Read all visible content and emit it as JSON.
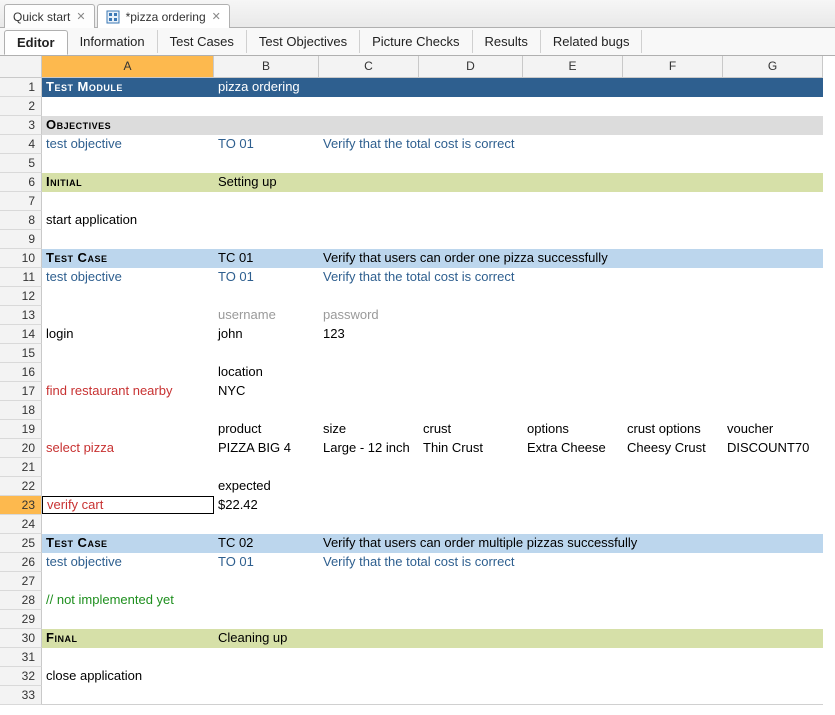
{
  "doc_tabs": [
    {
      "label": "Quick start",
      "active": false,
      "has_icon": false
    },
    {
      "label": "*pizza ordering",
      "active": true,
      "has_icon": true
    }
  ],
  "sub_tabs": [
    {
      "label": "Editor",
      "active": true
    },
    {
      "label": "Information",
      "active": false
    },
    {
      "label": "Test Cases",
      "active": false
    },
    {
      "label": "Test Objectives",
      "active": false
    },
    {
      "label": "Picture Checks",
      "active": false
    },
    {
      "label": "Results",
      "active": false
    },
    {
      "label": "Related bugs",
      "active": false
    }
  ],
  "columns": [
    "A",
    "B",
    "C",
    "D",
    "E",
    "F",
    "G"
  ],
  "selected_col": "A",
  "selected_row": 23,
  "rows": [
    {
      "n": 1,
      "bg": "module",
      "cells": [
        {
          "c": "A",
          "t": "Test Module",
          "cls": "t-head"
        },
        {
          "c": "B",
          "t": "pizza ordering"
        }
      ]
    },
    {
      "n": 2,
      "bg": "white",
      "cells": []
    },
    {
      "n": 3,
      "bg": "gray",
      "cells": [
        {
          "c": "A",
          "t": "Objectives",
          "cls": "t-head"
        }
      ]
    },
    {
      "n": 4,
      "bg": "white",
      "cells": [
        {
          "c": "A",
          "t": "test objective",
          "cls": "t-link"
        },
        {
          "c": "B",
          "t": "TO 01",
          "cls": "t-link"
        },
        {
          "c": "C",
          "t": "Verify that the total cost is correct",
          "cls": "t-link",
          "span": 5
        }
      ]
    },
    {
      "n": 5,
      "bg": "white",
      "cells": []
    },
    {
      "n": 6,
      "bg": "olive",
      "cells": [
        {
          "c": "A",
          "t": "Initial",
          "cls": "t-head"
        },
        {
          "c": "B",
          "t": "Setting up"
        }
      ]
    },
    {
      "n": 7,
      "bg": "white",
      "cells": []
    },
    {
      "n": 8,
      "bg": "white",
      "cells": [
        {
          "c": "A",
          "t": "start application"
        }
      ]
    },
    {
      "n": 9,
      "bg": "white",
      "cells": []
    },
    {
      "n": 10,
      "bg": "blue",
      "cells": [
        {
          "c": "A",
          "t": "Test Case",
          "cls": "t-head"
        },
        {
          "c": "B",
          "t": "TC 01"
        },
        {
          "c": "C",
          "t": "Verify that users can order one pizza successfully",
          "span": 5
        }
      ]
    },
    {
      "n": 11,
      "bg": "white",
      "cells": [
        {
          "c": "A",
          "t": "test objective",
          "cls": "t-link"
        },
        {
          "c": "B",
          "t": "TO 01",
          "cls": "t-link"
        },
        {
          "c": "C",
          "t": "Verify that the total cost is correct",
          "cls": "t-link",
          "span": 5
        }
      ]
    },
    {
      "n": 12,
      "bg": "white",
      "cells": []
    },
    {
      "n": 13,
      "bg": "white",
      "cells": [
        {
          "c": "B",
          "t": "username",
          "cls": "t-muted"
        },
        {
          "c": "C",
          "t": "password",
          "cls": "t-muted"
        }
      ]
    },
    {
      "n": 14,
      "bg": "white",
      "cells": [
        {
          "c": "A",
          "t": "login"
        },
        {
          "c": "B",
          "t": "john"
        },
        {
          "c": "C",
          "t": "123"
        }
      ]
    },
    {
      "n": 15,
      "bg": "white",
      "cells": []
    },
    {
      "n": 16,
      "bg": "white",
      "cells": [
        {
          "c": "B",
          "t": "location"
        }
      ]
    },
    {
      "n": 17,
      "bg": "white",
      "cells": [
        {
          "c": "A",
          "t": "find restaurant nearby",
          "cls": "t-red"
        },
        {
          "c": "B",
          "t": "NYC"
        }
      ]
    },
    {
      "n": 18,
      "bg": "white",
      "cells": []
    },
    {
      "n": 19,
      "bg": "white",
      "cells": [
        {
          "c": "B",
          "t": "product"
        },
        {
          "c": "C",
          "t": "size"
        },
        {
          "c": "D",
          "t": "crust"
        },
        {
          "c": "E",
          "t": "options"
        },
        {
          "c": "F",
          "t": "crust options"
        },
        {
          "c": "G",
          "t": "voucher"
        }
      ]
    },
    {
      "n": 20,
      "bg": "white",
      "cells": [
        {
          "c": "A",
          "t": "select pizza",
          "cls": "t-red"
        },
        {
          "c": "B",
          "t": "PIZZA BIG 4"
        },
        {
          "c": "C",
          "t": "Large - 12 inch"
        },
        {
          "c": "D",
          "t": "Thin Crust"
        },
        {
          "c": "E",
          "t": "Extra Cheese"
        },
        {
          "c": "F",
          "t": "Cheesy Crust"
        },
        {
          "c": "G",
          "t": "DISCOUNT70"
        }
      ]
    },
    {
      "n": 21,
      "bg": "white",
      "cells": []
    },
    {
      "n": 22,
      "bg": "white",
      "cells": [
        {
          "c": "B",
          "t": "expected"
        }
      ]
    },
    {
      "n": 23,
      "bg": "white",
      "cells": [
        {
          "c": "A",
          "t": "verify cart",
          "cls": "t-red",
          "editing": true
        },
        {
          "c": "B",
          "t": "$22.42"
        }
      ]
    },
    {
      "n": 24,
      "bg": "white",
      "cells": []
    },
    {
      "n": 25,
      "bg": "blue",
      "cells": [
        {
          "c": "A",
          "t": "Test Case",
          "cls": "t-head"
        },
        {
          "c": "B",
          "t": "TC 02"
        },
        {
          "c": "C",
          "t": "Verify that users can order multiple pizzas successfully",
          "span": 5
        }
      ]
    },
    {
      "n": 26,
      "bg": "white",
      "cells": [
        {
          "c": "A",
          "t": "test objective",
          "cls": "t-link"
        },
        {
          "c": "B",
          "t": "TO 01",
          "cls": "t-link"
        },
        {
          "c": "C",
          "t": "Verify that the total cost is correct",
          "cls": "t-link",
          "span": 5
        }
      ]
    },
    {
      "n": 27,
      "bg": "white",
      "cells": []
    },
    {
      "n": 28,
      "bg": "white",
      "cells": [
        {
          "c": "A",
          "t": "// not implemented yet",
          "cls": "t-green",
          "span": 7
        }
      ]
    },
    {
      "n": 29,
      "bg": "white",
      "cells": []
    },
    {
      "n": 30,
      "bg": "olive",
      "cells": [
        {
          "c": "A",
          "t": "Final",
          "cls": "t-head"
        },
        {
          "c": "B",
          "t": "Cleaning up"
        }
      ]
    },
    {
      "n": 31,
      "bg": "white",
      "cells": []
    },
    {
      "n": 32,
      "bg": "white",
      "cells": [
        {
          "c": "A",
          "t": "close application"
        }
      ]
    },
    {
      "n": 33,
      "bg": "white",
      "cells": []
    }
  ]
}
